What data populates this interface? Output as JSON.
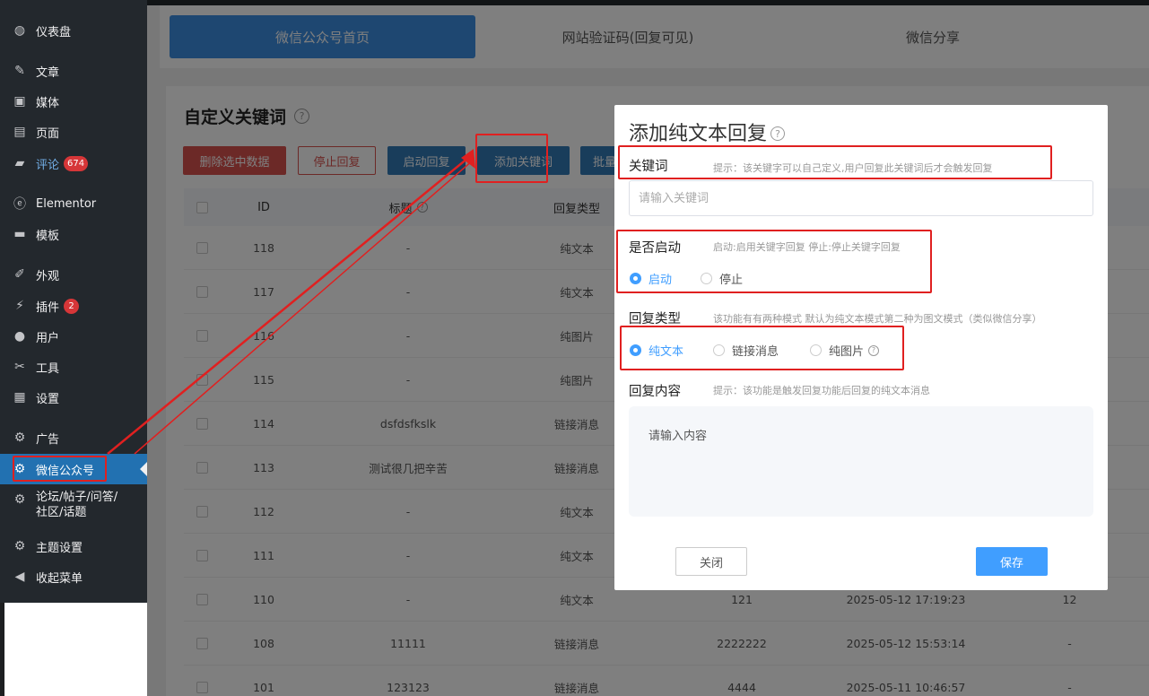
{
  "sidebar": {
    "items": [
      {
        "label": "仪表盘",
        "icon": "dashboard-icon"
      },
      {
        "label": "文章",
        "icon": "pin-icon"
      },
      {
        "label": "媒体",
        "icon": "media-icon"
      },
      {
        "label": "页面",
        "icon": "page-icon"
      },
      {
        "label": "评论",
        "icon": "comment-icon",
        "badge": "674"
      },
      {
        "label": "Elementor",
        "icon": "elementor-icon"
      },
      {
        "label": "模板",
        "icon": "folder-icon"
      },
      {
        "label": "外观",
        "icon": "brush-icon"
      },
      {
        "label": "插件",
        "icon": "plugin-icon",
        "badge": "2"
      },
      {
        "label": "用户",
        "icon": "user-icon"
      },
      {
        "label": "工具",
        "icon": "wrench-icon"
      },
      {
        "label": "设置",
        "icon": "settings-icon"
      },
      {
        "label": "广告",
        "icon": "gear-icon"
      },
      {
        "label": "微信公众号",
        "icon": "gear-icon"
      },
      {
        "label": "论坛/帖子/问答/社区/话题",
        "icon": "gear-icon"
      },
      {
        "label": "主题设置",
        "icon": "gear-icon"
      },
      {
        "label": "收起菜单",
        "icon": "collapse-icon"
      }
    ]
  },
  "tabs": [
    "微信公众号首页",
    "网站验证码(回复可见)",
    "微信分享"
  ],
  "page": {
    "title": "自定义关键词",
    "buttons": {
      "delete_selected": "删除选中数据",
      "stop_reply": "停止回复",
      "start_reply": "启动回复",
      "add_keyword": "添加关键词",
      "batch": "批量"
    }
  },
  "table": {
    "headers": {
      "id": "ID",
      "title": "标题",
      "reply_type": "回复类型"
    },
    "rows": [
      {
        "id": "118",
        "title": "-",
        "type": "纯文本",
        "extra1": "",
        "time": "",
        "count": ""
      },
      {
        "id": "117",
        "title": "-",
        "type": "纯文本",
        "extra1": "",
        "time": "",
        "count": ""
      },
      {
        "id": "116",
        "title": "-",
        "type": "纯图片",
        "extra1": "",
        "time": "",
        "count": ""
      },
      {
        "id": "115",
        "title": "-",
        "type": "纯图片",
        "extra1": "",
        "time": "",
        "count": ""
      },
      {
        "id": "114",
        "title": "dsfdsfkslk",
        "type": "链接消息",
        "extra1": "",
        "time": "",
        "count": ""
      },
      {
        "id": "113",
        "title": "测试很几把辛苦",
        "type": "链接消息",
        "extra1": "",
        "time": "",
        "count": ""
      },
      {
        "id": "112",
        "title": "-",
        "type": "纯文本",
        "extra1": "",
        "time": "",
        "count": ""
      },
      {
        "id": "111",
        "title": "-",
        "type": "纯文本",
        "extra1": "",
        "time": "",
        "count": ""
      },
      {
        "id": "110",
        "title": "-",
        "type": "纯文本",
        "extra1": "121",
        "time": "2025-05-12 17:19:23",
        "count": "12"
      },
      {
        "id": "108",
        "title": "11111",
        "type": "链接消息",
        "extra1": "2222222",
        "time": "2025-05-12 15:53:14",
        "count": "-"
      },
      {
        "id": "101",
        "title": "123123",
        "type": "链接消息",
        "extra1": "4444",
        "time": "2025-05-11 10:46:57",
        "count": "-"
      }
    ]
  },
  "modal": {
    "title": "添加纯文本回复",
    "keyword_label": "关键词",
    "keyword_hint": "提示：该关键字可以自己定义,用户回复此关键词后才会触发回复",
    "keyword_placeholder": "请输入关键词",
    "enable_label": "是否启动",
    "enable_hint": "启动:启用关键字回复 停止:停止关键字回复",
    "enable_on": "启动",
    "enable_off": "停止",
    "type_label": "回复类型",
    "type_hint": "该功能有有两种模式 默认为纯文本模式第二种为图文模式（类似微信分享）",
    "type_text": "纯文本",
    "type_link": "链接消息",
    "type_image": "纯图片",
    "content_label": "回复内容",
    "content_hint": "提示：该功能是触发回复功能后回复的纯文本消息",
    "content_placeholder": "请输入内容",
    "close_label": "关闭",
    "save_label": "保存"
  },
  "colors": {
    "annotation": "#e02020",
    "primary": "#409eff",
    "sidebar_bg": "#23282d"
  }
}
